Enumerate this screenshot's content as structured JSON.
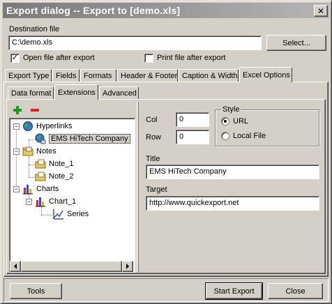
{
  "window": {
    "title": "Export dialog -- Export to [demo.xls]",
    "close_glyph": "✕"
  },
  "destination": {
    "label": "Destination file",
    "value": "C:\\demo.xls",
    "select_button": "Select...",
    "open_after_export_label": "Open file after export",
    "open_after_export_checked": true,
    "print_after_export_label": "Print file after export",
    "print_after_export_checked": false
  },
  "main_tabs": [
    "Export Type",
    "Fields",
    "Formats",
    "Header & Footer",
    "Caption & Width",
    "Excel Options"
  ],
  "main_tabs_active": "Excel Options",
  "sub_tabs": [
    "Data format",
    "Extensions",
    "Advanced"
  ],
  "sub_tabs_active": "Extensions",
  "toolbar": {
    "add_icon": "green-plus-icon",
    "remove_icon": "red-minus-icon"
  },
  "tree": {
    "hyperlinks": "Hyperlinks",
    "hyperlink_item": "EMS HiTech Company",
    "notes": "Notes",
    "note1": "Note_1",
    "note2": "Note_2",
    "charts": "Charts",
    "chart1": "Chart_1",
    "series": "Series",
    "expander_glyph": "−"
  },
  "details": {
    "col_label": "Col",
    "col_value": "0",
    "row_label": "Row",
    "row_value": "0",
    "style_label": "Style",
    "style_url": "URL",
    "style_local": "Local File",
    "style_selected": "URL",
    "title_label": "Title",
    "title_value": "EMS HiTech Company",
    "target_label": "Target",
    "target_value": "http://www.quickexport.net"
  },
  "footer": {
    "tools": "Tools",
    "start_export": "Start Export",
    "close": "Close"
  }
}
